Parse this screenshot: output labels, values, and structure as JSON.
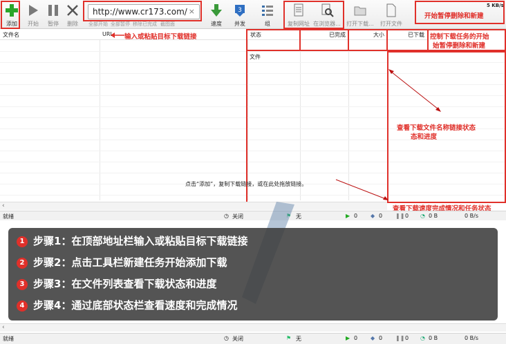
{
  "toolbar": {
    "add_label": "添加",
    "start_label": "开始",
    "pause_label": "暂停",
    "delete_label": "删除",
    "url_value": "http://www.cr173.com/",
    "clear_symbol": "×",
    "subtabs": [
      "全部开始",
      "全部暂停",
      "移除已完成",
      "截图面"
    ],
    "speed_label": "速度",
    "concurrency_label": "并发",
    "group_label": "组",
    "copy_url_label": "复制网址",
    "in_browser_label": "在浏览器...",
    "open_download_label": "打开下载...",
    "open_file_label": "打开文件",
    "speed_readout": "5 KB/s"
  },
  "annotations": {
    "input_url": "输入或粘贴目标下载链接",
    "start_pause": "开始暂停删除和新建",
    "control_tasks_line1": "控制下载任务的开始",
    "control_tasks_line2": "始暂停删除和新建",
    "view_files_line1": "查看下载文件名称链接状态",
    "view_files_line2": "态和进度",
    "view_speed": "查看下载速度完成情况和任务状态"
  },
  "columns": {
    "filename": "文件名",
    "url": "URL",
    "status": "状态",
    "completed": "已完成",
    "size": "大小",
    "downloaded": "已下载",
    "file": "文件"
  },
  "hint": "点击“添加”，复制下载链接，或在此处拖放链接。",
  "statusbar": {
    "ready": "就绪",
    "close": "关闭",
    "none": "无",
    "count_a": "0",
    "count_b": "0",
    "count_c": "0",
    "bytes": "0 B",
    "rate_top": "0 B/s",
    "rate_bottom": "0 B/s"
  },
  "steps": [
    {
      "num": "1",
      "text": "步骤1：在顶部地址栏输入或粘贴目标下载链接"
    },
    {
      "num": "2",
      "text": "步骤2：点击工具栏新建任务开始添加下载"
    },
    {
      "num": "3",
      "text": "步骤3：在文件列表查看下载状态和进度"
    },
    {
      "num": "4",
      "text": "步骤4：通过底部状态栏查看速度和完成情况"
    }
  ],
  "colors": {
    "accent_red": "#e0302a",
    "add_green": "#2aa52a"
  }
}
